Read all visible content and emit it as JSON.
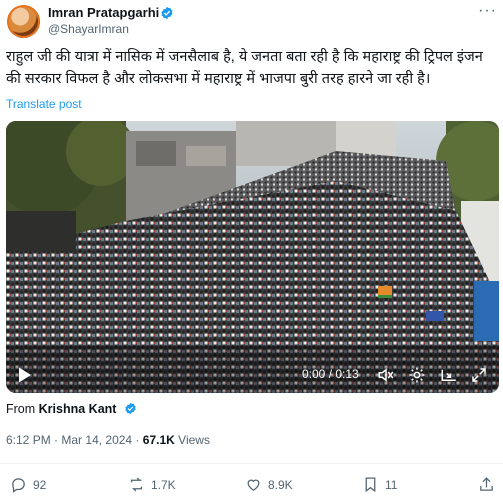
{
  "author": {
    "name": "Imran Pratapgarhi",
    "handle": "@ShayarImran"
  },
  "tweet": {
    "text": "राहुल जी की यात्रा में नासिक में जनसैलाब है, ये जनता बता रही है कि महाराष्ट्र की ट्रिपल इंजन की सरकार विफल है और लोकसभा में महाराष्ट्र में भाजपा बुरी तरह हारने जा रही है।",
    "translate_label": "Translate post"
  },
  "video": {
    "time": "0:00 / 0:13",
    "progress_fraction": 0.0
  },
  "source": {
    "prefix": "From",
    "name": "Krishna Kant"
  },
  "meta": {
    "time": "6:12 PM",
    "date": "Mar 14, 2024",
    "views_count": "67.1K",
    "views_label": "Views"
  },
  "actions": {
    "replies": "92",
    "reposts": "1.7K",
    "likes": "8.9K",
    "bookmarks": "11"
  },
  "colors": {
    "accent": "#1d9bf0",
    "muted": "#536471",
    "text": "#0f1419"
  },
  "icons": [
    "verified-badge-icon",
    "more-icon",
    "play-icon",
    "volume-icon",
    "settings-icon",
    "pip-icon",
    "fullscreen-icon",
    "reply-icon",
    "repost-icon",
    "like-icon",
    "bookmark-icon",
    "share-icon"
  ]
}
